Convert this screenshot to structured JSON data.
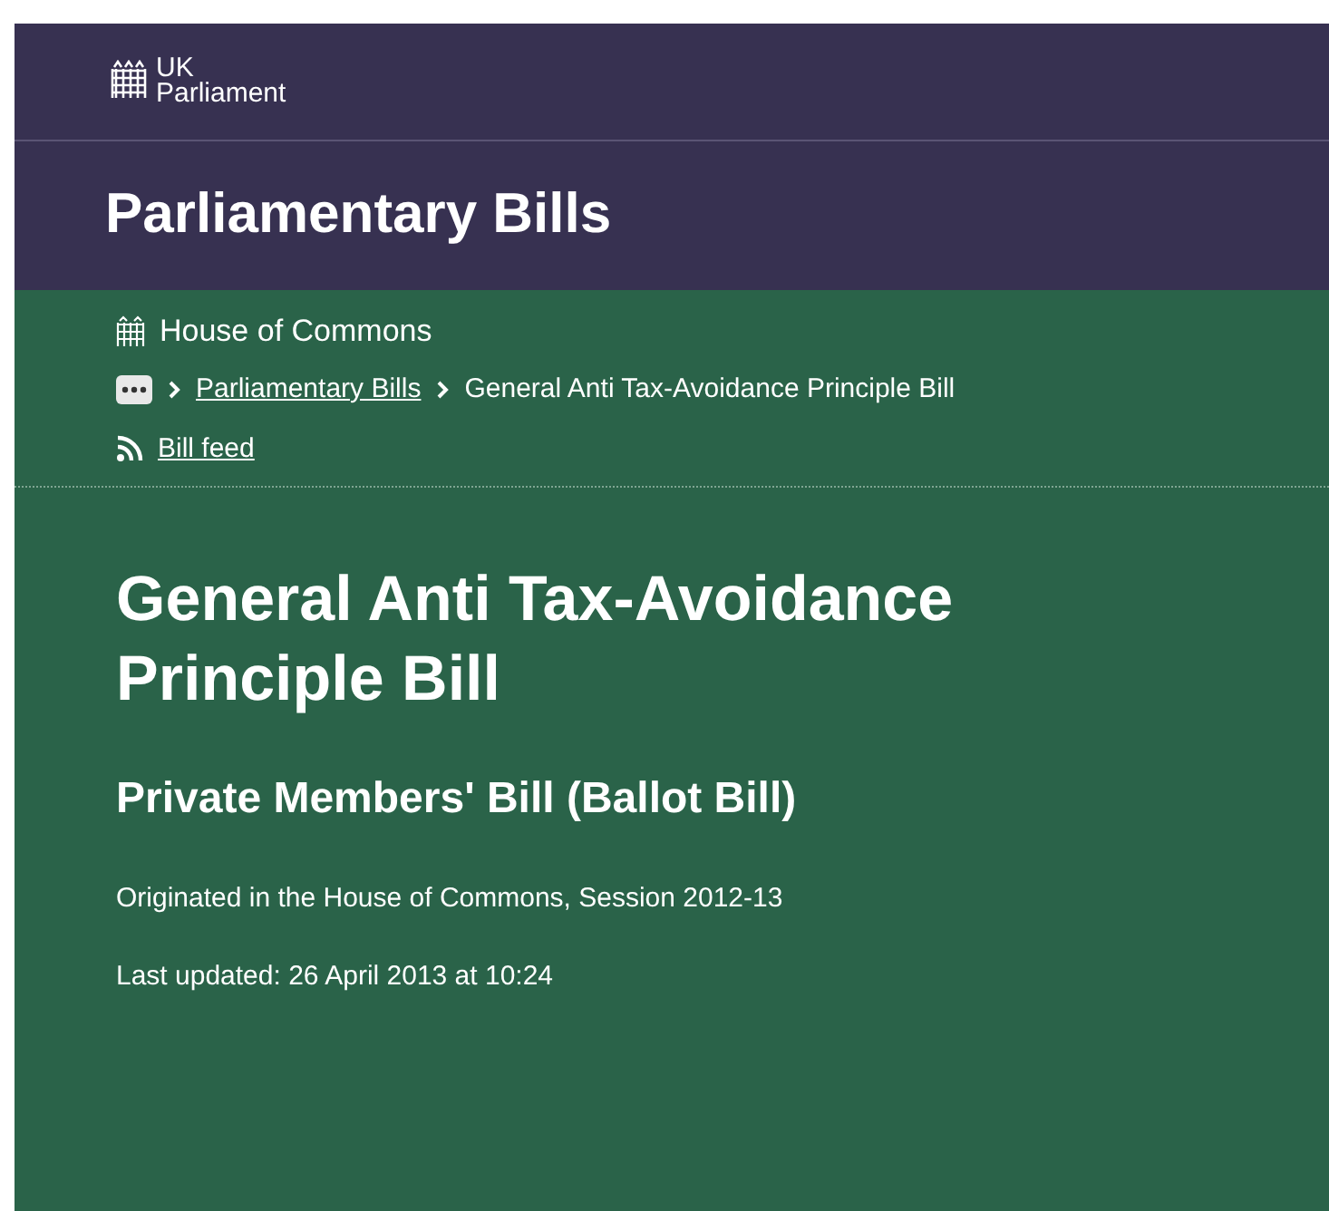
{
  "header": {
    "logo_text": [
      "UK",
      "Parliament"
    ],
    "title": "Parliamentary Bills"
  },
  "house": "House of Commons",
  "breadcrumbs": [
    {
      "label": "Parliamentary Bills",
      "kind": "link"
    },
    {
      "label": "General Anti Tax-Avoidance Principle Bill",
      "kind": "current"
    }
  ],
  "feed_link": "Bill feed",
  "bill": {
    "title": "General Anti Tax-Avoidance Principle Bill",
    "type": "Private Members' Bill (Ballot Bill)",
    "origin": "Originated in the House of Commons, Session 2012-13",
    "updated": "Last updated: 26 April 2013 at 10:24"
  }
}
